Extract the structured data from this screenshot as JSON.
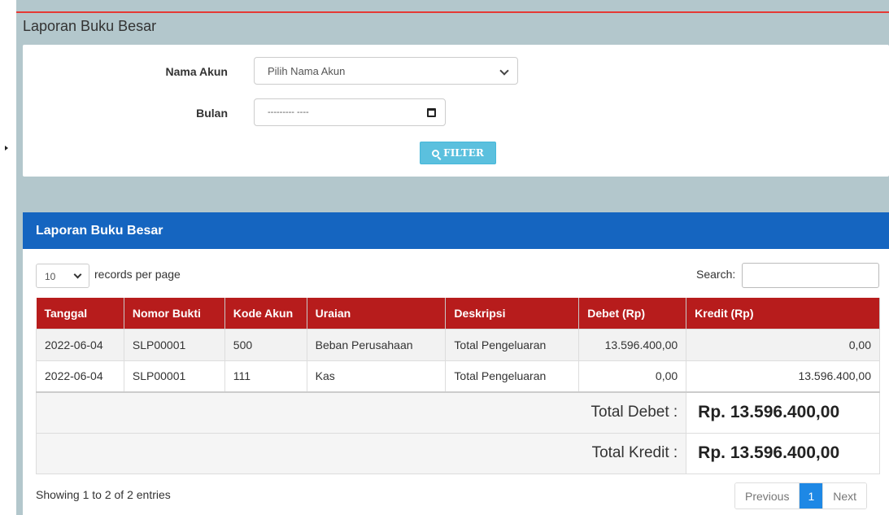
{
  "page": {
    "title": "Laporan Buku Besar"
  },
  "filter": {
    "account_label": "Nama Akun",
    "account_value": "Pilih Nama Akun",
    "month_label": "Bulan",
    "month_value": "--------- ----",
    "button_label": "FILTER"
  },
  "report": {
    "title": "Laporan Buku Besar",
    "page_length": "10",
    "page_length_label": "records per page",
    "search_label": "Search:",
    "search_value": "",
    "columns": [
      "Tanggal",
      "Nomor Bukti",
      "Kode Akun",
      "Uraian",
      "Deskripsi",
      "Debet (Rp)",
      "Kredit (Rp)"
    ],
    "rows": [
      [
        "2022-06-04",
        "SLP00001",
        "500",
        "Beban Perusahaan",
        "Total Pengeluaran",
        "13.596.400,00",
        "0,00"
      ],
      [
        "2022-06-04",
        "SLP00001",
        "111",
        "Kas",
        "Total Pengeluaran",
        "0,00",
        "13.596.400,00"
      ]
    ],
    "totals": {
      "debet_label": "Total Debet :",
      "debet_value": "Rp. 13.596.400,00",
      "kredit_label": "Total Kredit :",
      "kredit_value": "Rp. 13.596.400,00"
    },
    "info": "Showing 1 to 2 of 2 entries",
    "pagination": {
      "previous": "Previous",
      "current": "1",
      "next": "Next"
    }
  },
  "colors": {
    "header_blue": "#1565c0",
    "table_header_red": "#b71c1c",
    "filter_button": "#5bc0de",
    "page_background": "#b3c7cc",
    "active_page": "#1e88e5"
  },
  "icons": {
    "filter_button": "search-icon",
    "account_select": "chevron-down-icon",
    "month_picker": "calendar-icon",
    "sidebar_toggle": "caret-right-icon"
  }
}
